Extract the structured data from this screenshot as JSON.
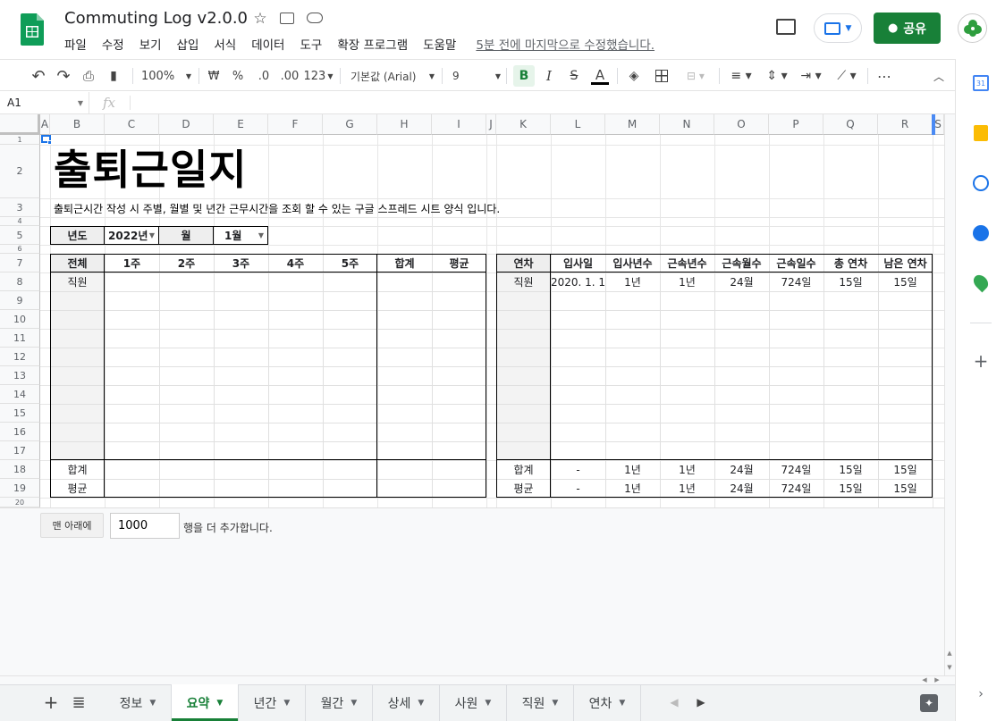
{
  "doc": {
    "title": "Commuting Log v2.0.0",
    "last_edit": "5분 전에 마지막으로 수정했습니다.",
    "share_label": "공유"
  },
  "menu": [
    "파일",
    "수정",
    "보기",
    "삽입",
    "서식",
    "데이터",
    "도구",
    "확장 프로그램",
    "도움말"
  ],
  "toolbar": {
    "zoom": "100%",
    "currency": "₩",
    "percent": "%",
    "dec_less": ".0",
    "dec_more": ".00",
    "format123": "123",
    "font": "기본값 (Arial)",
    "font_size": "9",
    "bold": "B",
    "italic": "I",
    "strike": "S",
    "text_color": "A"
  },
  "formula_bar": {
    "cell_ref": "A1",
    "fx": "fx",
    "value": ""
  },
  "columns": [
    "A",
    "B",
    "C",
    "D",
    "E",
    "F",
    "G",
    "H",
    "I",
    "J",
    "K",
    "L",
    "M",
    "N",
    "O",
    "P",
    "Q",
    "R",
    "S"
  ],
  "rows": [
    "1",
    "2",
    "3",
    "4",
    "5",
    "6",
    "7",
    "8",
    "9",
    "10",
    "11",
    "12",
    "13",
    "14",
    "15",
    "16",
    "17",
    "18",
    "19",
    "20"
  ],
  "sheet": {
    "title": "출퇴근일지",
    "subtitle": "출퇴근시간 작성 시 주별, 월별 및 년간 근무시간을 조회 할 수 있는 구글 스프레드 시트 양식 입니다.",
    "year_label": "년도",
    "year_value": "2022년",
    "month_label": "월",
    "month_value": "1월",
    "left_headers": [
      "전체",
      "1주",
      "2주",
      "3주",
      "4주",
      "5주",
      "합계",
      "평균"
    ],
    "left_row_employee": "직원",
    "left_total": "합계",
    "left_avg": "평균",
    "right_headers": [
      "연차",
      "입사일",
      "입사년수",
      "근속년수",
      "근속월수",
      "근속일수",
      "총 연차",
      "남은 연차"
    ],
    "right_row": [
      "직원",
      "2020. 1. 1",
      "1년",
      "1년",
      "24월",
      "724일",
      "15일",
      "15일"
    ],
    "right_total": [
      "합계",
      "-",
      "1년",
      "1년",
      "24월",
      "724일",
      "15일",
      "15일"
    ],
    "right_avg": [
      "평균",
      "-",
      "1년",
      "1년",
      "24월",
      "724일",
      "15일",
      "15일"
    ]
  },
  "add_rows": {
    "button": "맨 아래에",
    "count": "1000",
    "suffix": "행을 더 추가합니다."
  },
  "tabs": [
    "정보",
    "요약",
    "년간",
    "월간",
    "상세",
    "사원",
    "직원",
    "연차"
  ],
  "active_tab": "요약",
  "colors": {
    "green": "#188038",
    "blue": "#1a73e8"
  }
}
